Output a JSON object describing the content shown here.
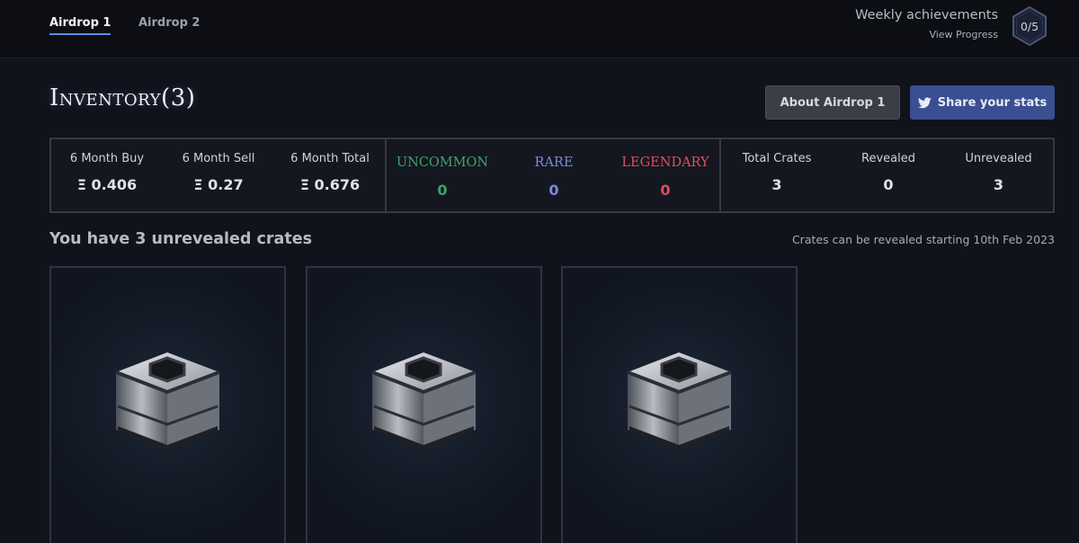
{
  "tabs": [
    {
      "label": "Airdrop 1",
      "active": true
    },
    {
      "label": "Airdrop 2",
      "active": false
    }
  ],
  "achievements": {
    "title": "Weekly achievements",
    "link": "View Progress",
    "progress": "0/5"
  },
  "inventory": {
    "title": "Inventory(3)"
  },
  "buttons": {
    "about": "About Airdrop 1",
    "share": "Share your stats",
    "share_icon": "twitter-icon"
  },
  "stats": {
    "buy": {
      "label": "6 Month Buy",
      "value": "Ξ 0.406"
    },
    "sell": {
      "label": "6 Month Sell",
      "value": "Ξ 0.27"
    },
    "total": {
      "label": "6 Month Total",
      "value": "Ξ 0.676"
    },
    "uncommon": {
      "label": "UNCOMMON",
      "value": "0",
      "color": "#3fa36a"
    },
    "rare": {
      "label": "RARE",
      "value": "0",
      "color": "#7d88d6"
    },
    "legendary": {
      "label": "LEGENDARY",
      "value": "0",
      "color": "#d9505e"
    },
    "total_crates": {
      "label": "Total Crates",
      "value": "3"
    },
    "revealed": {
      "label": "Revealed",
      "value": "0"
    },
    "unrevealed": {
      "label": "Unrevealed",
      "value": "3"
    }
  },
  "crates": {
    "heading": "You have 3 unrevealed crates",
    "note": "Crates can be revealed starting 10th Feb 2023",
    "items": [
      {
        "icon": "crate-icon"
      },
      {
        "icon": "crate-icon"
      },
      {
        "icon": "crate-icon"
      }
    ]
  }
}
